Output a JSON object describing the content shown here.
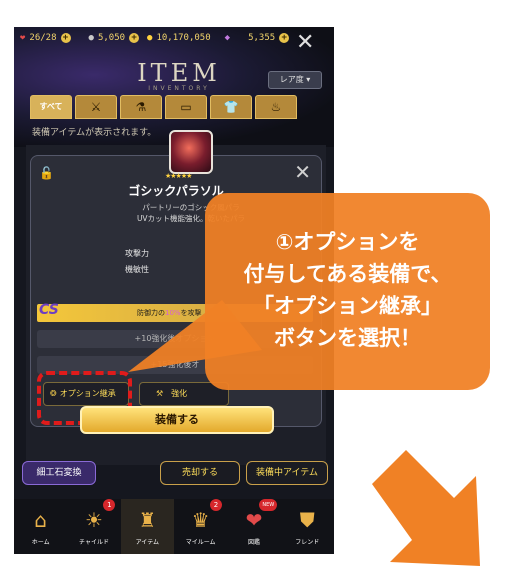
{
  "status": {
    "stamina": "26/28",
    "coins": "5,050",
    "gold": "10,170,050",
    "gems": "5,355"
  },
  "header": {
    "title": "ITEM",
    "subtitle": "INVENTORY",
    "rarity_filter": "レア度 ▾"
  },
  "tabs": [
    {
      "label": "すべて"
    },
    {
      "label": "⚔"
    },
    {
      "label": "⚗"
    },
    {
      "label": "▭"
    },
    {
      "label": "👕"
    },
    {
      "label": "♨"
    }
  ],
  "list_info": "装備アイテムが表示されます。",
  "item": {
    "stars": "★★★★★",
    "name": "ゴシックパラソル",
    "description_1": "パートリーのゴシック風パラ",
    "description_2": "UVカット機能強化。乾いたパラ",
    "stats": [
      {
        "label": "攻撃力"
      },
      {
        "label": "機敏性"
      }
    ],
    "option_badge": "CS",
    "option_text_pre": "防御力の",
    "option_text_pct": "10%",
    "option_text_post": "を攻撃",
    "option_rows": [
      {
        "text": "+10強化後オプション"
      },
      {
        "text": "+15強化後オ"
      }
    ]
  },
  "buttons": {
    "option_inherit": "オプション継承",
    "enhance": "強化",
    "equip": "装備する",
    "gem_exchange": "細工石変換",
    "sell": "売却する",
    "equipped_items": "装備中アイテム"
  },
  "nav": [
    {
      "label": "ホーム",
      "icon": "home-icon",
      "glyph": "⌂",
      "badge": ""
    },
    {
      "label": "チャイルド",
      "icon": "child-icon",
      "glyph": "☀",
      "badge": "1"
    },
    {
      "label": "アイテム",
      "icon": "item-icon",
      "glyph": "♜",
      "badge": ""
    },
    {
      "label": "マイルーム",
      "icon": "myroom-icon",
      "glyph": "♛",
      "badge": "2"
    },
    {
      "label": "図鑑",
      "icon": "book-icon",
      "glyph": "❤",
      "badge": "NEW"
    },
    {
      "label": "フレンド",
      "icon": "friend-icon",
      "glyph": "⛊",
      "badge": ""
    }
  ],
  "callout": {
    "line1": "①オプションを",
    "line2": "付与してある装備で、",
    "line3": "「オプション継承」",
    "line4": "ボタンを選択！"
  },
  "colors": {
    "callout": "#f08125",
    "highlight": "#e01b1b",
    "accent_gold": "#e3a92c"
  }
}
